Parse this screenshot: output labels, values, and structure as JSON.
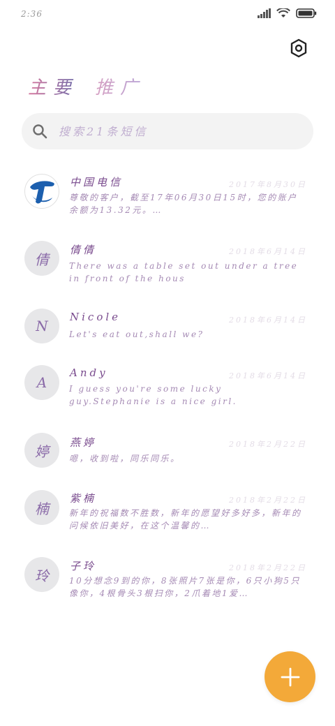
{
  "status_bar": {
    "time": "2:36",
    "icons": [
      "signal-icon",
      "wifi-icon",
      "battery-icon"
    ]
  },
  "header": {
    "settings_icon": "gear-icon",
    "tabs": [
      {
        "label": "主要",
        "active": true
      },
      {
        "label": "推广",
        "active": false
      }
    ]
  },
  "search": {
    "placeholder": "搜索21条短信",
    "icon": "search-icon"
  },
  "messages": [
    {
      "avatar": "",
      "avatar_icon": "china-telecom-logo",
      "name": "中国电信",
      "date": "2017年8月30日",
      "preview": "尊敬的客户，截至17年06月30日15时，您的账户余额为13.32元。…"
    },
    {
      "avatar": "倩",
      "name": "倩倩",
      "date": "2018年6月14日",
      "preview": "There was a table set out under a tree in front of the hous"
    },
    {
      "avatar": "N",
      "name": "Nicole",
      "date": "2018年6月14日",
      "preview": "Let's eat out,shall we?"
    },
    {
      "avatar": "A",
      "name": "Andy",
      "date": "2018年6月14日",
      "preview": "I guess you're some lucky guy.Stephanie is a nice girl."
    },
    {
      "avatar": "婷",
      "name": "燕婷",
      "date": "2018年2月22日",
      "preview": "嗯，收到啦，同乐同乐。"
    },
    {
      "avatar": "楠",
      "name": "紫楠",
      "date": "2018年2月22日",
      "preview": "新年的祝福数不胜数，新年的愿望好多好多，新年的问候依旧美好，在这个温馨的…"
    },
    {
      "avatar": "玲",
      "name": "子玲",
      "date": "2018年2月22日",
      "preview": "10分想念9到的你，8张照片7张是你，6只小狗5只像你，4根骨头3根扫你，2爪着地1爱…"
    }
  ],
  "fab": {
    "icon": "plus-icon"
  },
  "colors": {
    "accent": "#f3a939",
    "text_purple": "#7a4c8e",
    "avatar_bg": "#e7e7e9"
  }
}
